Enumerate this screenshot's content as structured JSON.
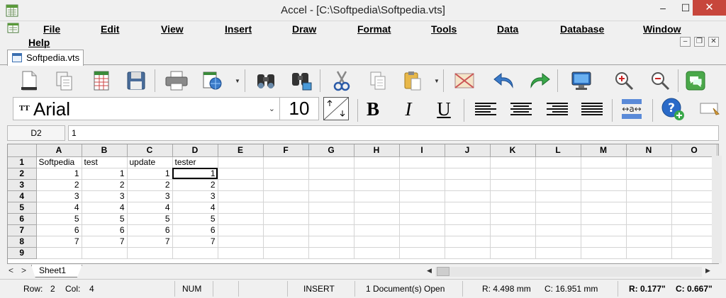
{
  "window": {
    "title": "Accel - [C:\\Softpedia\\Softpedia.vts]",
    "minimize": "–",
    "maximize": "☐",
    "close": "✕"
  },
  "menu": {
    "file": "File",
    "edit": "Edit",
    "view": "View",
    "insert": "Insert",
    "draw": "Draw",
    "format": "Format",
    "tools": "Tools",
    "data": "Data",
    "database": "Database",
    "window": "Window",
    "help": "Help"
  },
  "mdi": {
    "minimize": "–",
    "restore": "❐",
    "close": "✕"
  },
  "tab": {
    "label": "Softpedia.vts"
  },
  "toolbar": {
    "icons": [
      "new-document-icon",
      "copy-document-icon",
      "spreadsheet-icon",
      "save-icon",
      "print-icon",
      "export-globe-icon",
      "find-icon",
      "find-replace-icon",
      "cut-icon",
      "copy-icon",
      "paste-icon",
      "image-icon",
      "undo-icon",
      "redo-icon",
      "monitor-icon",
      "zoom-in-icon",
      "zoom-out-icon",
      "chat-icon"
    ]
  },
  "format": {
    "font_family": "Arial",
    "font_size": "10",
    "bold": "B",
    "italic": "I",
    "underline": "U",
    "tt": "TT",
    "dropdown_arrow": "⌄"
  },
  "formula": {
    "cell_ref": "D2",
    "value": "1"
  },
  "grid": {
    "columns": [
      "A",
      "B",
      "C",
      "D",
      "E",
      "F",
      "G",
      "H",
      "I",
      "J",
      "K",
      "L",
      "M",
      "N",
      "O"
    ],
    "rows": [
      {
        "n": "1",
        "cells": [
          "Softpedia",
          "test",
          "update",
          "tester"
        ]
      },
      {
        "n": "2",
        "cells": [
          "1",
          "1",
          "1",
          "1"
        ]
      },
      {
        "n": "3",
        "cells": [
          "2",
          "2",
          "2",
          "2"
        ]
      },
      {
        "n": "4",
        "cells": [
          "3",
          "3",
          "3",
          "3"
        ]
      },
      {
        "n": "5",
        "cells": [
          "4",
          "4",
          "4",
          "4"
        ]
      },
      {
        "n": "6",
        "cells": [
          "5",
          "5",
          "5",
          "5"
        ]
      },
      {
        "n": "7",
        "cells": [
          "6",
          "6",
          "6",
          "6"
        ]
      },
      {
        "n": "8",
        "cells": [
          "7",
          "7",
          "7",
          "7"
        ]
      },
      {
        "n": "9",
        "cells": [
          "",
          "",
          "",
          ""
        ]
      }
    ]
  },
  "sheets": {
    "nav_prev": "<",
    "nav_next": ">",
    "active": "Sheet1",
    "scroll_left": "◀",
    "scroll_right": "▶"
  },
  "status": {
    "row_label": "Row:",
    "row": "2",
    "col_label": "Col:",
    "col": "4",
    "num": "NUM",
    "insert": "INSERT",
    "docs": "1 Document(s) Open",
    "r_mm": "R: 4.498 mm",
    "c_mm": "C: 16.951 mm",
    "r_in": "R: 0.177\"",
    "c_in": "C: 0.667\""
  }
}
